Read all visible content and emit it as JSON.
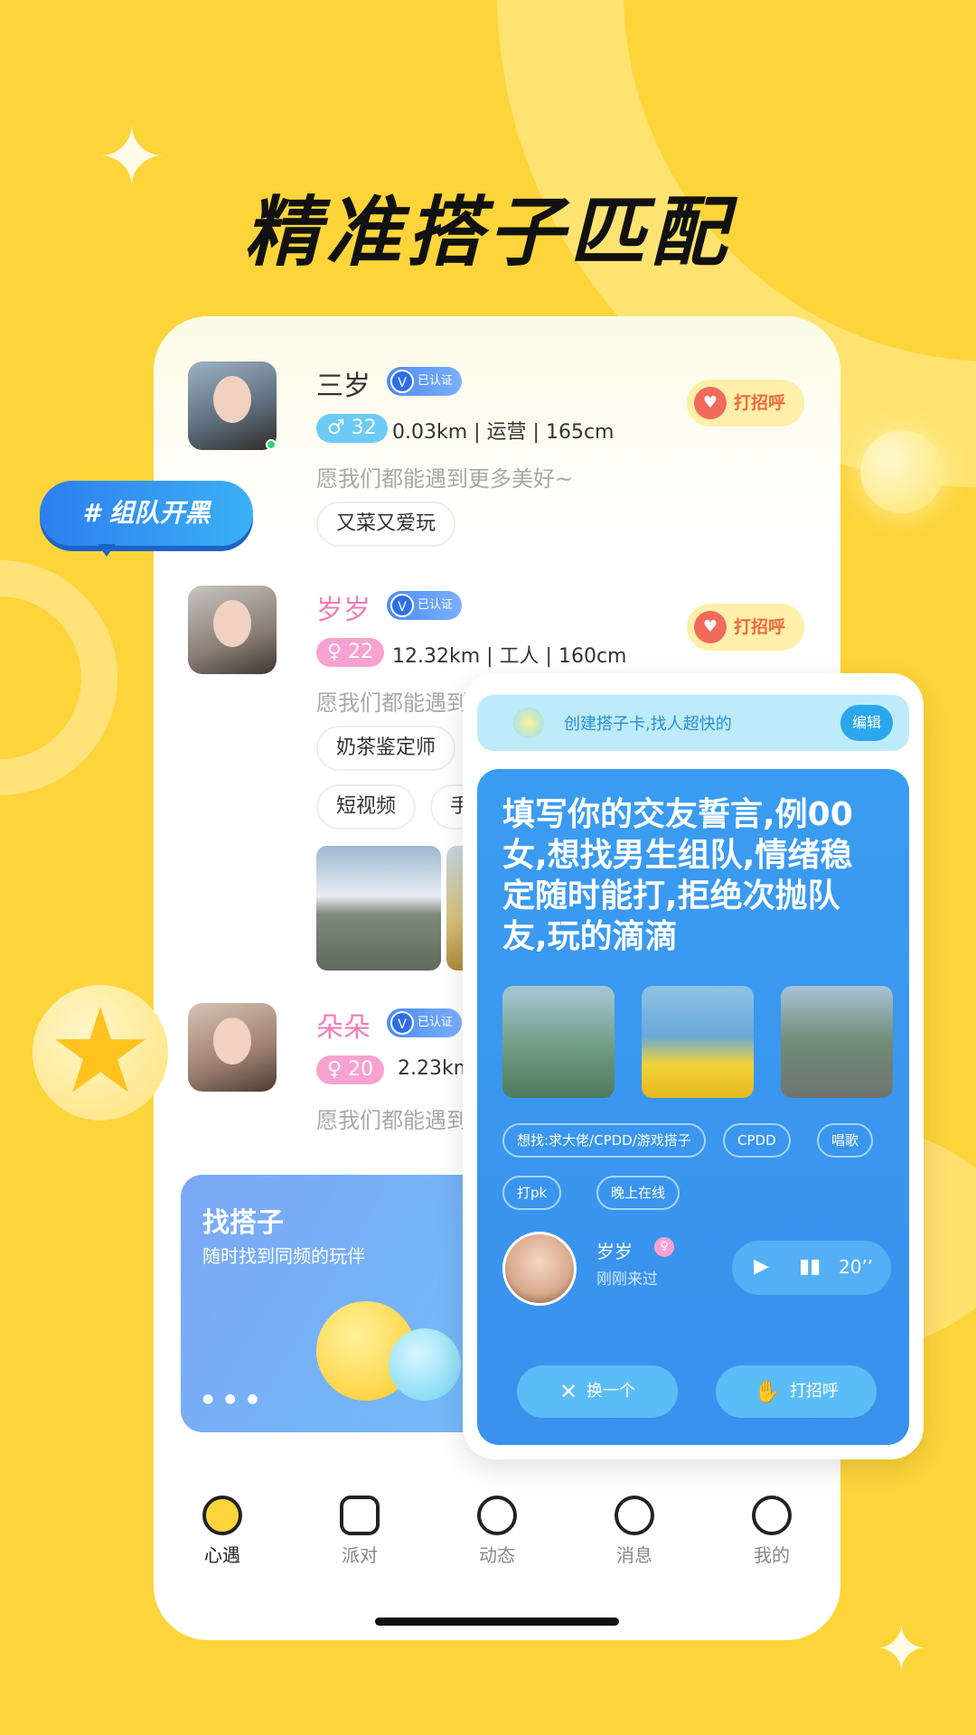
{
  "headline": "精准搭子匹配",
  "team_pill": "# 组队开黑",
  "users": [
    {
      "name": "三岁",
      "verified": "已认证",
      "gender_symbol": "♂",
      "age": "32",
      "info": "0.03km | 运营 | 165cm",
      "motto": "愿我们都能遇到更多美好~",
      "tags": [
        "又菜又爱玩"
      ],
      "greet": "打招呼"
    },
    {
      "name": "岁岁",
      "verified": "已认证",
      "gender_symbol": "♀",
      "age": "22",
      "info": "12.32km | 工人 | 160cm",
      "motto": "愿我们都能遇到",
      "tags": [
        "奶茶鉴定师",
        "短视频",
        "手"
      ],
      "greet": "打招呼"
    },
    {
      "name": "朵朵",
      "verified": "已认证",
      "gender_symbol": "♀",
      "age": "20",
      "info": "2.23km",
      "motto": "愿我们都能遇到"
    }
  ],
  "banner": {
    "title": "找搭子",
    "subtitle": "随时找到同频的玩伴"
  },
  "tabs": [
    {
      "label": "心遇",
      "icon": "heart-icon"
    },
    {
      "label": "派对",
      "icon": "trend-icon"
    },
    {
      "label": "动态",
      "icon": "compass-icon"
    },
    {
      "label": "消息",
      "icon": "chat-icon"
    },
    {
      "label": "我的",
      "icon": "smile-icon"
    }
  ],
  "card": {
    "create_text": "创建搭子卡,找人超快的",
    "edit_label": "编辑",
    "pledge": "填写你的交友誓言,例00女,想找男生组队,情绪稳定随时能打,拒绝次抛队友,玩的滴滴",
    "tags": [
      "想找:求大佬/CPDD/游戏搭子",
      "CPDD",
      "唱歌",
      "打pk",
      "晚上在线"
    ],
    "user_name": "岁岁",
    "user_status": "刚刚来过",
    "voice_duration": "20’’",
    "skip_label": "换一个",
    "greet_label": "打招呼"
  },
  "colors": {
    "background": "#FDD43A",
    "accent_blue": "#3A9CF0",
    "pink": "#F27BB9"
  }
}
